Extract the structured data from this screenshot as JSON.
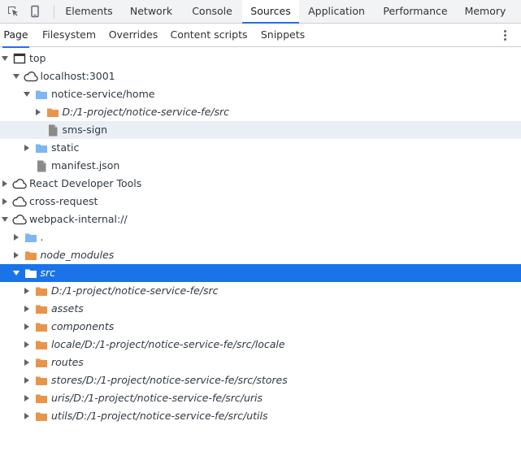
{
  "toolbar": {
    "inspect_icon": "inspect-element-icon",
    "device_icon": "device-toolbar-icon",
    "tabs": [
      {
        "label": "Elements",
        "active": false
      },
      {
        "label": "Network",
        "active": false
      },
      {
        "label": "Console",
        "active": false
      },
      {
        "label": "Sources",
        "active": true
      },
      {
        "label": "Application",
        "active": false
      },
      {
        "label": "Performance",
        "active": false
      },
      {
        "label": "Memory",
        "active": false
      }
    ]
  },
  "navigator": {
    "tabs": [
      {
        "label": "Page",
        "active": true
      },
      {
        "label": "Filesystem",
        "active": false
      },
      {
        "label": "Overrides",
        "active": false
      },
      {
        "label": "Content scripts",
        "active": false
      },
      {
        "label": "Snippets",
        "active": false
      }
    ],
    "more_icon": "more-options-icon"
  },
  "tree": [
    {
      "label": "top",
      "icon": "frame-icon",
      "expanded": true
    },
    {
      "label": "localhost:3001",
      "icon": "cloud-icon",
      "expanded": true
    },
    {
      "label": "notice-service/home",
      "icon": "folder-icon",
      "expanded": true
    },
    {
      "label": "D:/1-project/notice-service-fe/src",
      "icon": "folder-icon",
      "expanded": false
    },
    {
      "label": "sms-sign",
      "icon": "file-icon"
    },
    {
      "label": "static",
      "icon": "folder-icon",
      "expanded": false
    },
    {
      "label": "manifest.json",
      "icon": "file-icon"
    },
    {
      "label": "React Developer Tools",
      "icon": "cloud-icon",
      "expanded": false
    },
    {
      "label": "cross-request",
      "icon": "cloud-icon",
      "expanded": false
    },
    {
      "label": "webpack-internal://",
      "icon": "cloud-icon",
      "expanded": true
    },
    {
      "label": ".",
      "icon": "folder-icon",
      "expanded": false
    },
    {
      "label": "node_modules",
      "icon": "folder-icon",
      "expanded": false
    },
    {
      "label": "src",
      "icon": "folder-icon",
      "expanded": true
    },
    {
      "label": "D:/1-project/notice-service-fe/src",
      "icon": "folder-icon",
      "expanded": false
    },
    {
      "label": "assets",
      "icon": "folder-icon",
      "expanded": false
    },
    {
      "label": "components",
      "icon": "folder-icon",
      "expanded": false
    },
    {
      "label": "locale/D:/1-project/notice-service-fe/src/locale",
      "icon": "folder-icon",
      "expanded": false
    },
    {
      "label": "routes",
      "icon": "folder-icon",
      "expanded": false
    },
    {
      "label": "stores/D:/1-project/notice-service-fe/src/stores",
      "icon": "folder-icon",
      "expanded": false
    },
    {
      "label": "uris/D:/1-project/notice-service-fe/src/uris",
      "icon": "folder-icon",
      "expanded": false
    },
    {
      "label": "utils/D:/1-project/notice-service-fe/src/utils",
      "icon": "folder-icon",
      "expanded": false
    }
  ],
  "colors": {
    "accent": "#1a73e8",
    "folder_blue": "#7cb6f5",
    "folder_orange": "#e8954a",
    "file_gray": "#8a8a8a",
    "hover_row": "#eaeef5"
  }
}
